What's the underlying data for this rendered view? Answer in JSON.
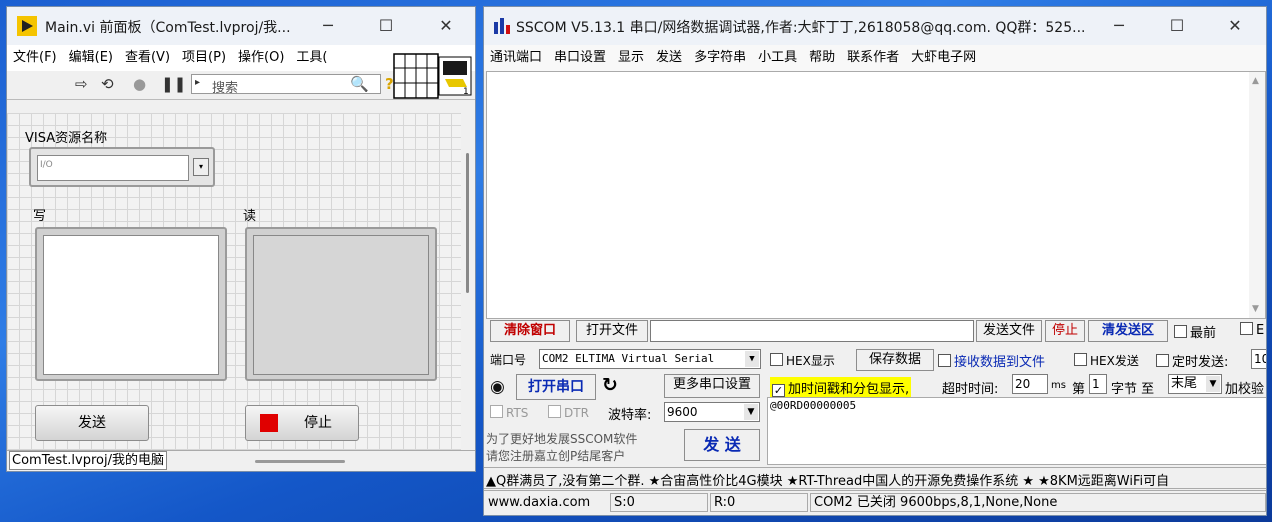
{
  "labview": {
    "title": "Main.vi 前面板（ComTest.lvproj/我...",
    "menu": [
      "文件(F)",
      "编辑(E)",
      "查看(V)",
      "项目(P)",
      "操作(O)",
      "工具("
    ],
    "search_placeholder": "搜索",
    "visa_label": "VISA资源名称",
    "visa_prefix": "I/O",
    "write_label": "写",
    "read_label": "读",
    "send_button": "发送",
    "stop_button": "停止",
    "status_path": "ComTest.lvproj/我的电脑"
  },
  "sscom": {
    "title": "SSCOM V5.13.1 串口/网络数据调试器,作者:大虾丁丁,2618058@qq.com. QQ群：525...",
    "menu": [
      "通讯端口",
      "串口设置",
      "显示",
      "发送",
      "多字符串",
      "小工具",
      "帮助",
      "联系作者",
      "大虾电子网"
    ],
    "row1": {
      "clear_window": "清除窗口",
      "open_file": "打开文件",
      "send_file": "发送文件",
      "stop": "停止",
      "clear_send": "清发送区",
      "topmost": "最前",
      "english": "E"
    },
    "port_label": "端口号",
    "port_value": "COM2 ELTIMA Virtual Serial",
    "hex_display": "HEX显示",
    "save_data": "保存数据",
    "recv_to_file": "接收数据到文件",
    "hex_send": "HEX发送",
    "timed_send": "定时发送:",
    "timed_value": "10",
    "open_port": "打开串口",
    "more_settings": "更多串口设置",
    "timestamp": "加时间戳和分包显示,",
    "timeout_label": "超时时间:",
    "timeout_value": "20",
    "ms": "ms",
    "nth_label": "第",
    "nth_value": "1",
    "byte_to": "字节 至",
    "tail_value": "末尾",
    "checksum": "加校验",
    "rts": "RTS",
    "dtr": "DTR",
    "baud_label": "波特率:",
    "baud_value": "9600",
    "send_text": "@00RD00000005",
    "promo_line1": "为了更好地发展SSCOM软件",
    "promo_line2": "请您注册嘉立创P结尾客户",
    "send_button": "发 送",
    "ticker": "▲Q群满员了,没有第二个群. ★合宙高性价比4G模块 ★RT-Thread中国人的开源免费操作系统 ★ ★8KM远距离WiFi可自",
    "status": {
      "site": "www.daxia.com",
      "s": "S:0",
      "r": "R:0",
      "port_status": "COM2 已关闭  9600bps,8,1,None,None"
    }
  }
}
